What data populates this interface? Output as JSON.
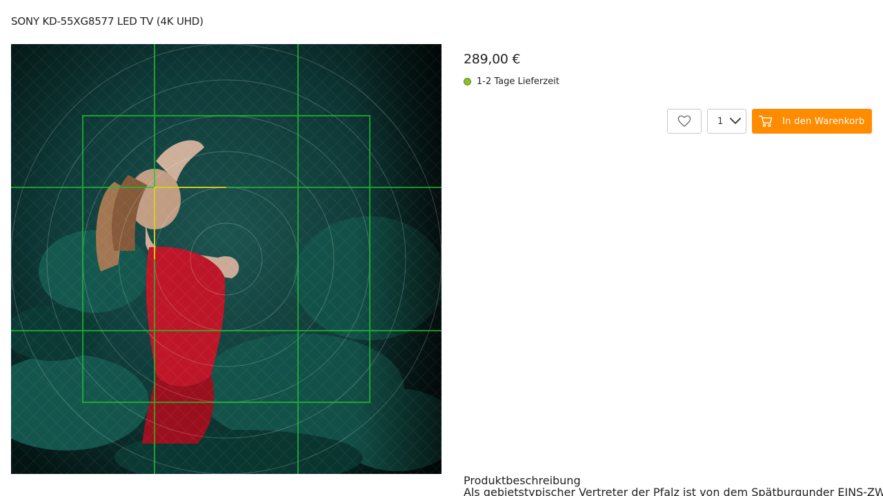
{
  "product": {
    "title": "SONY KD-55XG8577 LED TV (4K UHD)",
    "price": "289,00 €",
    "delivery": "1-2 Tage Lieferzeit",
    "delivery_status_color": "#8bbf2c"
  },
  "actions": {
    "wishlist_icon": "heart-icon",
    "quantity": "1",
    "cart_icon": "cart-icon",
    "cart_label": "In den Warenkorb",
    "cart_color": "#ff8c00"
  },
  "description": {
    "heading": "Produktbeschreibung",
    "text": "Als gebietstypischer Vertreter der Pfalz ist von dem Spätburgunder EINS-ZWEI-"
  }
}
